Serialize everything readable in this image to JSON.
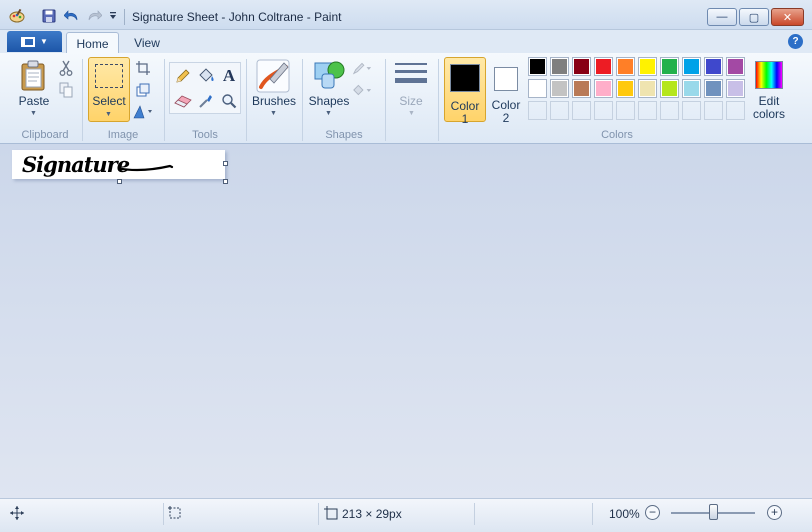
{
  "window": {
    "title": "Signature Sheet - John Coltrane - Paint"
  },
  "quick_access": {
    "icons": [
      "paint-app-icon",
      "save-icon",
      "undo-icon",
      "redo-icon",
      "customize-dropdown-icon"
    ]
  },
  "window_controls": {
    "minimize": "—",
    "maximize": "▢",
    "close": "✕"
  },
  "tabs": [
    {
      "label": "Home",
      "active": true
    },
    {
      "label": "View",
      "active": false
    }
  ],
  "help_label": "?",
  "ribbon": {
    "clipboard": {
      "paste_label": "Paste",
      "group_label": "Clipboard"
    },
    "image": {
      "select_label": "Select",
      "group_label": "Image"
    },
    "tools": {
      "group_label": "Tools",
      "text_tool_glyph": "A"
    },
    "brushes": {
      "label": "Brushes"
    },
    "shapes": {
      "label": "Shapes",
      "group_label": "Shapes"
    },
    "size": {
      "label": "Size"
    },
    "colors": {
      "color1_line1": "Color",
      "color1_line2": "1",
      "color2_line1": "Color",
      "color2_line2": "2",
      "edit_line1": "Edit",
      "edit_line2": "colors",
      "group_label": "Colors",
      "color1_value": "#000000",
      "color2_value": "#ffffff",
      "palette_row1": [
        "#000000",
        "#7f7f7f",
        "#880015",
        "#ed1c24",
        "#ff7f27",
        "#fff200",
        "#22b14c",
        "#00a2e8",
        "#3f48cc",
        "#a349a4"
      ],
      "palette_row2": [
        "#ffffff",
        "#c3c3c3",
        "#b97a57",
        "#ffaec9",
        "#ffc90e",
        "#efe4b0",
        "#b5e61d",
        "#99d9ea",
        "#7092be",
        "#c8bfe7"
      ]
    }
  },
  "canvas": {
    "signature_text": "Signature"
  },
  "status": {
    "image_size": "213 × 29px",
    "zoom": "100%",
    "zoom_out": "−",
    "zoom_in": "+"
  }
}
